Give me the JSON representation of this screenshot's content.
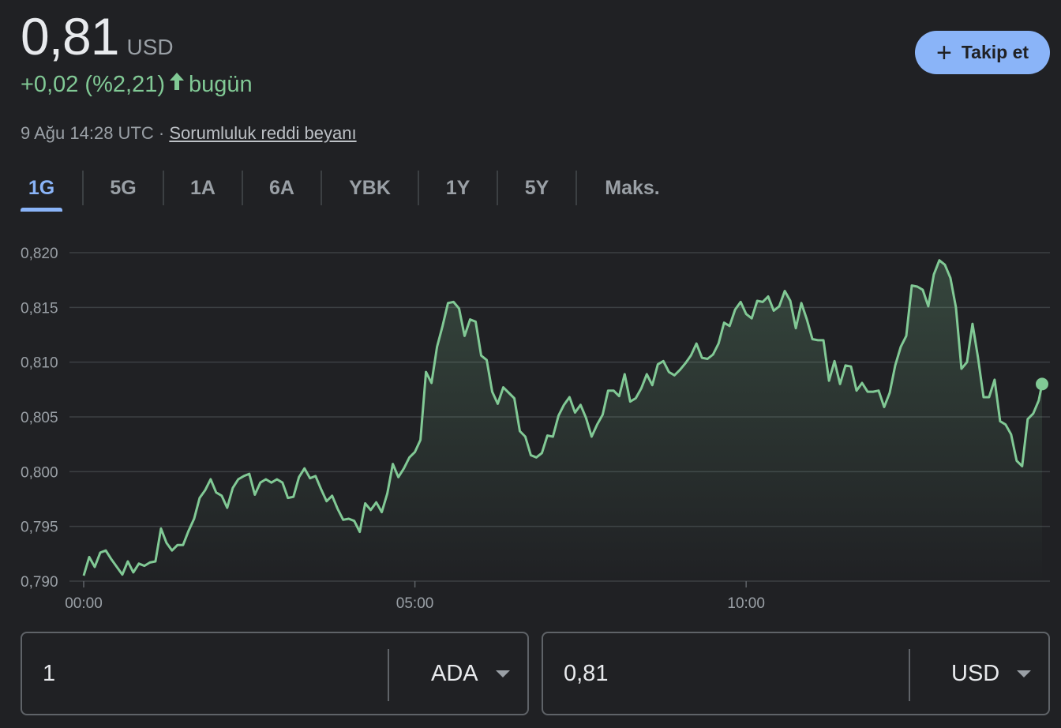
{
  "quote": {
    "price": "0,81",
    "currency": "USD",
    "change": "+0,02 (%2,21)",
    "change_suffix": "bugün",
    "timestamp": "9 Ağu 14:28 UTC ·",
    "disclaimer": "Sorumluluk reddi beyanı",
    "up_color": "#81c995"
  },
  "follow_button": {
    "label": "Takip et",
    "icon": "plus-icon"
  },
  "range_tabs": [
    {
      "label": "1G",
      "active": true
    },
    {
      "label": "5G",
      "active": false
    },
    {
      "label": "1A",
      "active": false
    },
    {
      "label": "6A",
      "active": false
    },
    {
      "label": "YBK",
      "active": false
    },
    {
      "label": "1Y",
      "active": false
    },
    {
      "label": "5Y",
      "active": false
    },
    {
      "label": "Maks.",
      "active": false
    }
  ],
  "chart_data": {
    "type": "area",
    "ylim": [
      0.79,
      0.82
    ],
    "y_ticks": [
      "0,820",
      "0,815",
      "0,810",
      "0,805",
      "0,800",
      "0,795",
      "0,790"
    ],
    "y_tick_values": [
      0.82,
      0.815,
      0.81,
      0.805,
      0.8,
      0.795,
      0.79
    ],
    "x_ticks": [
      "00:00",
      "05:00",
      "10:00"
    ],
    "x_tick_minutes": [
      0,
      300,
      600
    ],
    "x_range_minutes": [
      0,
      868
    ],
    "grid": true,
    "line_color": "#81c995",
    "series": [
      {
        "x": [
          0,
          5,
          10,
          15,
          20,
          25,
          30,
          35,
          40,
          45,
          50,
          55,
          60,
          65,
          70,
          75,
          80,
          85,
          90,
          95,
          100,
          105,
          110,
          115,
          120,
          125,
          130,
          135,
          140,
          145,
          150,
          155,
          160,
          165,
          170,
          175,
          180,
          185,
          190,
          195,
          200,
          205,
          210,
          215,
          220,
          225,
          230,
          235,
          240,
          245,
          250,
          255,
          260,
          265,
          270,
          275,
          280,
          285,
          290,
          295,
          300,
          305,
          310,
          315,
          320,
          325,
          330,
          335,
          340,
          345,
          350,
          355,
          360,
          365,
          370,
          375,
          380,
          385,
          390,
          395,
          400,
          405,
          410,
          415,
          420,
          425,
          430,
          435,
          440,
          445,
          450,
          455,
          460,
          465,
          470,
          475,
          480,
          485,
          490,
          495,
          500,
          505,
          510,
          515,
          520,
          525,
          530,
          535,
          540,
          545,
          550,
          555,
          560,
          565,
          570,
          575,
          580,
          585,
          590,
          595,
          600,
          605,
          610,
          615,
          620,
          625,
          630,
          635,
          640,
          645,
          650,
          655,
          660,
          665,
          670,
          675,
          680,
          685,
          690,
          695,
          700,
          705,
          710,
          715,
          720,
          725,
          730,
          735,
          740,
          745,
          750,
          755,
          760,
          765,
          770,
          775,
          780,
          785,
          790,
          795,
          800,
          805,
          810,
          815,
          820,
          825,
          830,
          835,
          840,
          845,
          850,
          855,
          860,
          865,
          868
        ],
        "values": [
          0.7905,
          0.7922,
          0.7913,
          0.7926,
          0.7928,
          0.792,
          0.7913,
          0.7906,
          0.7918,
          0.7908,
          0.7916,
          0.7914,
          0.7917,
          0.7918,
          0.7948,
          0.7935,
          0.7928,
          0.7933,
          0.7933,
          0.7946,
          0.7957,
          0.7976,
          0.7983,
          0.7993,
          0.7981,
          0.7978,
          0.7967,
          0.7985,
          0.7993,
          0.7996,
          0.7998,
          0.7979,
          0.799,
          0.7993,
          0.799,
          0.7993,
          0.799,
          0.7976,
          0.7977,
          0.7995,
          0.8003,
          0.7994,
          0.7996,
          0.7984,
          0.7973,
          0.7978,
          0.7966,
          0.7956,
          0.7957,
          0.7955,
          0.7945,
          0.7971,
          0.7965,
          0.7972,
          0.7963,
          0.798,
          0.8007,
          0.7995,
          0.8003,
          0.8013,
          0.8018,
          0.8029,
          0.8091,
          0.8081,
          0.8114,
          0.8133,
          0.8154,
          0.8155,
          0.8149,
          0.8124,
          0.8139,
          0.8137,
          0.8106,
          0.8102,
          0.8073,
          0.8062,
          0.8077,
          0.8072,
          0.8067,
          0.8037,
          0.8032,
          0.8015,
          0.8013,
          0.8017,
          0.8033,
          0.8032,
          0.8051,
          0.8061,
          0.8068,
          0.8054,
          0.8061,
          0.8049,
          0.8032,
          0.8043,
          0.8052,
          0.8074,
          0.8074,
          0.8069,
          0.8089,
          0.8064,
          0.8067,
          0.8076,
          0.8089,
          0.8079,
          0.8098,
          0.8101,
          0.8091,
          0.8088,
          0.8093,
          0.8099,
          0.8106,
          0.8117,
          0.8104,
          0.8103,
          0.8107,
          0.8117,
          0.8136,
          0.8133,
          0.8148,
          0.8155,
          0.8144,
          0.814,
          0.8156,
          0.8155,
          0.816,
          0.8147,
          0.8151,
          0.8165,
          0.8156,
          0.8131,
          0.8154,
          0.8139,
          0.8121,
          0.812,
          0.812,
          0.8083,
          0.8101,
          0.808,
          0.8097,
          0.8096,
          0.8074,
          0.8081,
          0.8073,
          0.8073,
          0.8074,
          0.8059,
          0.8072,
          0.8097,
          0.8114,
          0.8124,
          0.817,
          0.8169,
          0.8166,
          0.8151,
          0.818,
          0.8193,
          0.8189,
          0.8177,
          0.815,
          0.8094,
          0.81,
          0.8135,
          0.8104,
          0.8068,
          0.8068,
          0.8084,
          0.8046,
          0.8043,
          0.8034,
          0.801,
          0.8005,
          0.8048,
          0.8053,
          0.8065,
          0.808
        ]
      }
    ]
  },
  "converter": {
    "from_value": "1",
    "from_unit": "ADA",
    "to_value": "0,81",
    "to_unit": "USD"
  }
}
